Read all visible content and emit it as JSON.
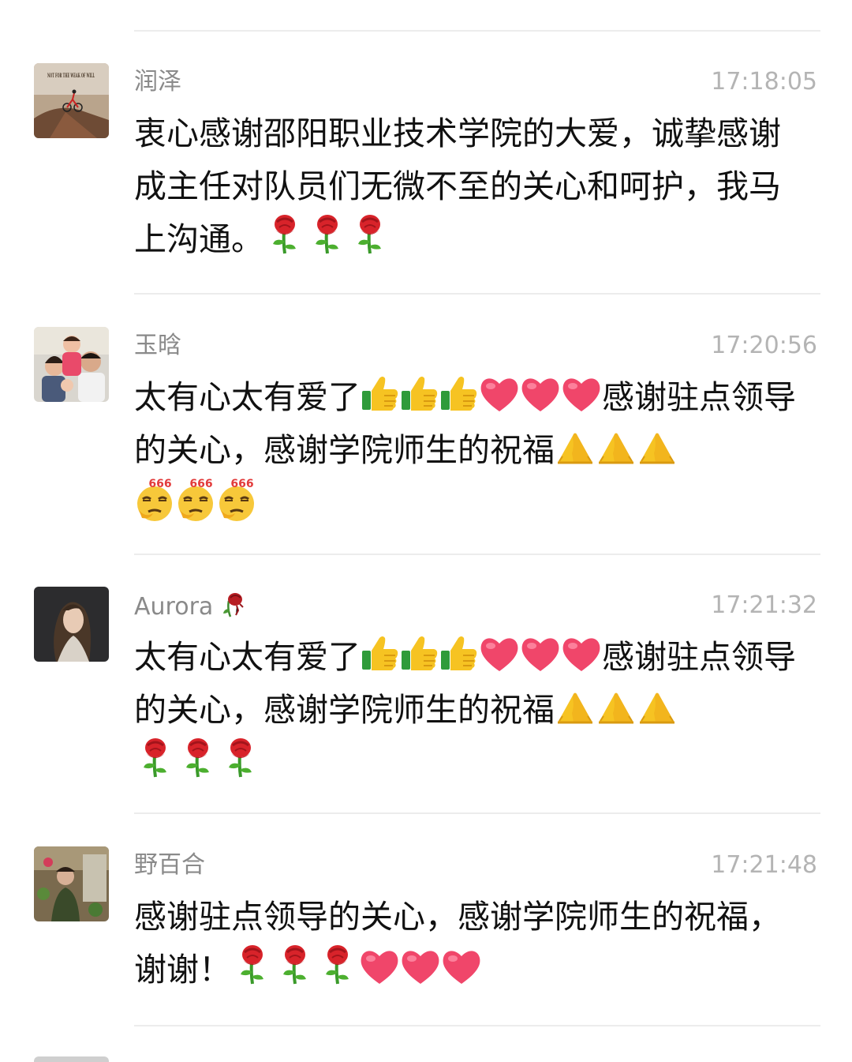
{
  "comments": [
    {
      "name": "润泽",
      "time": "17:18:05",
      "avatar_text": "NOT FOR THE WEAK OF WILL",
      "text": "衷心感谢邵阳职业技术学院的大爱，诚挚感谢成主任对队员们无微不至的关心和呵护，我马上沟通。",
      "emojis": [
        "rose",
        "rose",
        "rose"
      ]
    },
    {
      "name": "玉晗",
      "time": "17:20:56",
      "text_a": "太有心太有爱了",
      "emojis_a": [
        "thumbs-up",
        "thumbs-up",
        "thumbs-up",
        "heart",
        "heart",
        "heart"
      ],
      "text_b": "感谢驻点领导的关心，感谢学院师生的祝福",
      "emojis_b": [
        "pray",
        "pray",
        "pray",
        "666-face",
        "666-face",
        "666-face"
      ]
    },
    {
      "name": "Aurora",
      "time": "17:21:32",
      "text_a": "太有心太有爱了",
      "emojis_a": [
        "thumbs-up",
        "thumbs-up",
        "thumbs-up",
        "heart",
        "heart",
        "heart"
      ],
      "text_b": "感谢驻点领导的关心，感谢学院师生的祝福",
      "emojis_b": [
        "pray",
        "pray",
        "pray",
        "rose",
        "rose",
        "rose"
      ]
    },
    {
      "name": "野百合",
      "time": "17:21:48",
      "text": "感谢驻点领导的关心，感谢学院师生的祝福，谢谢！",
      "emojis": [
        "rose",
        "rose",
        "rose",
        "heart",
        "heart",
        "heart"
      ]
    }
  ],
  "emoji_texts": {
    "face_666": "666"
  },
  "colors": {
    "name": "#8a8a8a",
    "time": "#b4b4b4",
    "text": "#111111",
    "divider": "#ececec"
  }
}
